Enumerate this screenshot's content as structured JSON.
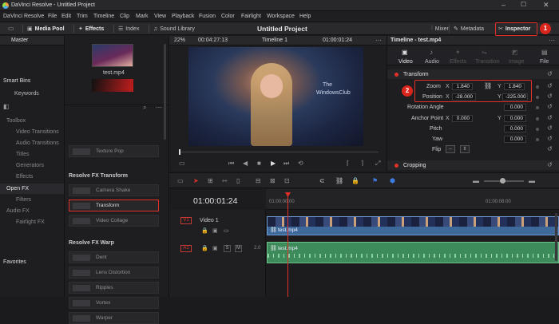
{
  "window": {
    "title": "DaVinci Resolve - Untitled Project"
  },
  "menu": [
    "DaVinci Resolve",
    "File",
    "Edit",
    "Trim",
    "Timeline",
    "Clip",
    "Mark",
    "View",
    "Playback",
    "Fusion",
    "Color",
    "Fairlight",
    "Workspace",
    "Help"
  ],
  "toolbar": {
    "media_pool": "Media Pool",
    "effects": "Effects",
    "index": "Index",
    "sound_library": "Sound Library",
    "project": "Untitled Project",
    "mixer": "Mixer",
    "metadata": "Metadata",
    "inspector": "Inspector"
  },
  "left": {
    "master": "Master",
    "smart_bins": "Smart Bins",
    "keywords": "Keywords",
    "toolbox": "Toolbox",
    "video_transitions": "Video Transitions",
    "audio_transitions": "Audio Transitions",
    "titles": "Titles",
    "generators": "Generators",
    "effects": "Effects",
    "open_fx": "Open FX",
    "filters": "Filters",
    "audio_fx": "Audio FX",
    "fairlight_fx": "Fairlight FX",
    "favorites": "Favorites"
  },
  "media": {
    "clip_name": "test.mp4"
  },
  "fx": {
    "texture_pop": "Texture Pop",
    "section_transform": "Resolve FX Transform",
    "camera_shake": "Camera Shake",
    "transform": "Transform",
    "video_collage": "Video Collage",
    "section_warp": "Resolve FX Warp",
    "dent": "Dent",
    "lens_distortion": "Lens Distortion",
    "ripples": "Ripples",
    "vortex": "Vortex",
    "warper": "Warper"
  },
  "viewer": {
    "zoom": "22%",
    "timecode_left": "00:04:27:13",
    "timeline": "Timeline 1",
    "timecode_right": "01:00:01:24",
    "watermark1": "The",
    "watermark2": "WindowsClub"
  },
  "inspector": {
    "title": "Timeline - test.mp4",
    "tabs": [
      "Video",
      "Audio",
      "Effects",
      "Transition",
      "Image",
      "File"
    ],
    "section": "Transform",
    "zoom_label": "Zoom",
    "zoom_x": "1.840",
    "zoom_y": "1.840",
    "position_label": "Position",
    "pos_x": "-28.000",
    "pos_y": "-225.000",
    "rotation_label": "Rotation Angle",
    "rotation": "0.000",
    "anchor_label": "Anchor Point",
    "anchor_x": "0.000",
    "anchor_y": "0.000",
    "pitch_label": "Pitch",
    "pitch": "0.000",
    "yaw_label": "Yaw",
    "yaw": "0.000",
    "flip_label": "Flip",
    "cropping": "Cropping",
    "x": "X",
    "y": "Y"
  },
  "timeline": {
    "timecode": "01:00:01:24",
    "ruler_start": "01:00:00:00",
    "ruler_mid": "01:00:08:00",
    "v1": "V1",
    "video1": "Video 1",
    "clip": "test.mp4",
    "a1": "A1",
    "a1_level": "2.0",
    "s": "S",
    "m": "M"
  },
  "annotations": {
    "badge1": "1",
    "badge2": "2"
  }
}
